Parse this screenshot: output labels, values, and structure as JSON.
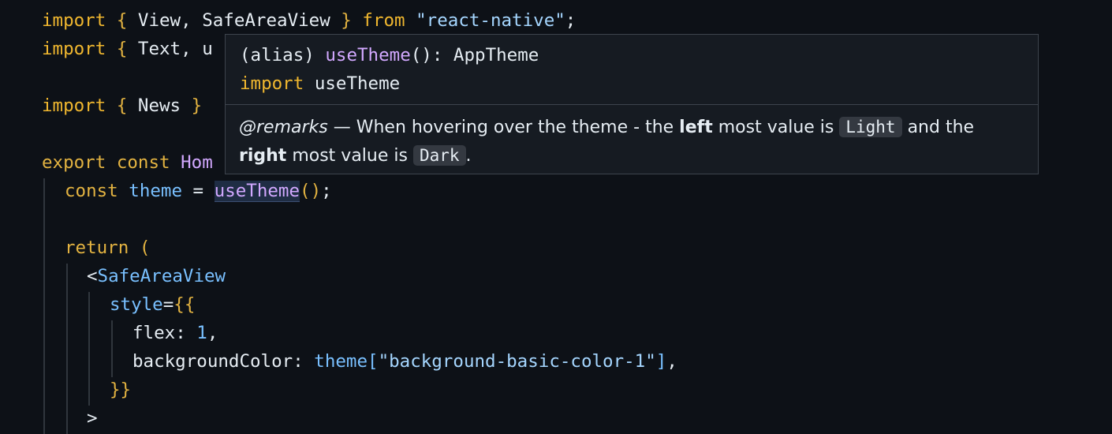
{
  "code": {
    "l1": {
      "kw": "import",
      "open": " { ",
      "names": "View, SafeAreaView",
      "close": " } ",
      "from": "from",
      "sp": " ",
      "mod": "\"react-native\"",
      "semi": ";"
    },
    "l2": {
      "kw": "import",
      "open": " { ",
      "names": "Text, u"
    },
    "l4": {
      "kw": "import",
      "open": " { ",
      "names": "News",
      "close": " }"
    },
    "l6": {
      "kw1": "export",
      "kw2": "const",
      "name": "Hom"
    },
    "l7": {
      "kw": "const",
      "var": "theme",
      "eq": " = ",
      "fn": "useTheme",
      "paren": "()",
      "semi": ";"
    },
    "l9": {
      "kw": "return",
      "paren": " ("
    },
    "l10": {
      "lt": "<",
      "tag": "SafeAreaView"
    },
    "l11": {
      "attr": "style",
      "eq": "=",
      "braces": "{{"
    },
    "l12": {
      "key": "flex",
      "colon": ": ",
      "num": "1",
      "comma": ","
    },
    "l13": {
      "key": "backgroundColor",
      "colon": ": ",
      "obj": "theme",
      "lb": "[",
      "str": "\"background-basic-color-1\"",
      "rb": "]",
      "comma": ","
    },
    "l14": {
      "braces": "}}"
    },
    "l15": {
      "gt": ">"
    }
  },
  "hover": {
    "alias": "(alias) ",
    "fn": "useTheme",
    "sig_rest": "(): AppTheme",
    "import_kw": "import",
    "import_name": " useTheme",
    "remarks_tag": "@remarks",
    "doc1_a": " — When hovering over the theme - the ",
    "doc1_bold": "left",
    "doc1_b": " most value is ",
    "chip_light": "Light",
    "doc1_c": " and the",
    "doc2_bold": "right",
    "doc2_a": " most value is ",
    "chip_dark": "Dark",
    "doc2_b": "."
  },
  "colors": {
    "background": "#0d1117",
    "keyword": "#e3b341",
    "string": "#a5d6ff",
    "function": "#d2a8ff",
    "variable": "#79c0ff",
    "tag": "#7ee787",
    "popup_bg": "#161b22"
  }
}
